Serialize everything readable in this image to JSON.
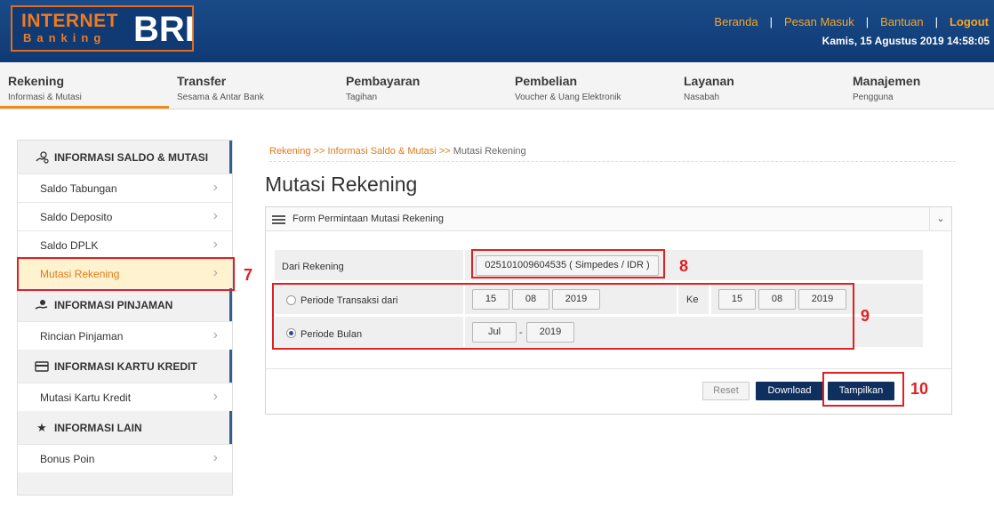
{
  "header": {
    "logo_internet": "INTERNET",
    "logo_banking": "Banking",
    "logo_bri": "BRI",
    "nav": [
      "Beranda",
      "Pesan Masuk",
      "Bantuan",
      "Logout"
    ],
    "separator": "|",
    "datetime": "Kamis, 15 Agustus 2019 14:58:05"
  },
  "menu": [
    {
      "title": "Rekening",
      "sub": "Informasi & Mutasi",
      "active": true
    },
    {
      "title": "Transfer",
      "sub": "Sesama & Antar Bank",
      "active": false
    },
    {
      "title": "Pembayaran",
      "sub": "Tagihan",
      "active": false
    },
    {
      "title": "Pembelian",
      "sub": "Voucher & Uang Elektronik",
      "active": false
    },
    {
      "title": "Layanan",
      "sub": "Nasabah",
      "active": false
    },
    {
      "title": "Manajemen",
      "sub": "Pengguna",
      "active": false
    }
  ],
  "sidebar": {
    "section1": {
      "label": "INFORMASI SALDO & MUTASI",
      "icon": "money-hand-icon"
    },
    "items1": [
      "Saldo Tabungan",
      "Saldo Deposito",
      "Saldo DPLK",
      "Mutasi Rekening"
    ],
    "section2": {
      "label": "INFORMASI PINJAMAN",
      "icon": "loan-hand-icon"
    },
    "items2": [
      "Rincian Pinjaman"
    ],
    "section3": {
      "label": "INFORMASI KARTU KREDIT",
      "icon": "credit-card-icon"
    },
    "items3": [
      "Mutasi Kartu Kredit"
    ],
    "section4": {
      "label": "INFORMASI LAIN",
      "icon": "star-icon"
    },
    "items4": [
      "Bonus Poin"
    ],
    "chevron": "›"
  },
  "annotations": [
    "7",
    "8",
    "9",
    "10"
  ],
  "main": {
    "breadcrumb": [
      "Rekening",
      ">>",
      "Informasi Saldo & Mutasi",
      ">>",
      "Mutasi Rekening"
    ],
    "title": "Mutasi Rekening",
    "panel_title": "Form Permintaan Mutasi Rekening",
    "collapse_icon": "⌄",
    "dari_rekening_label": "Dari Rekening",
    "account_value": "025101009604535 ( Simpedes / IDR )",
    "periode_transaksi_label": "Periode Transaksi dari",
    "from_date": {
      "day": "15",
      "month": "08",
      "year": "2019"
    },
    "ke_label": "Ke",
    "to_date": {
      "day": "15",
      "month": "08",
      "year": "2019"
    },
    "periode_bulan_label": "Periode Bulan",
    "bulan": {
      "month": "Jul",
      "year": "2019"
    },
    "dash": "-",
    "buttons": {
      "reset": "Reset",
      "download": "Download",
      "tampilkan": "Tampilkan"
    }
  },
  "colors": {
    "header_bg": "#0f3a74",
    "accent": "#f08c1e",
    "button_dark": "#0f2f5e",
    "annotation": "#e02020"
  }
}
